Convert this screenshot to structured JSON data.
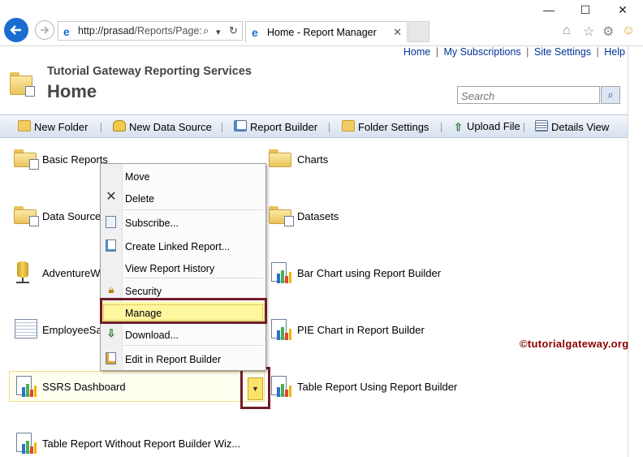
{
  "browser": {
    "address": "http://prasad/Reports/Page:",
    "address_host": "http://prasad",
    "address_path": "/Reports/Page:",
    "tab_title": "Home - Report Manager",
    "address_search_icon": "⌕",
    "address_refresh_icon": "↻"
  },
  "top_links": {
    "home": "Home",
    "subscriptions": "My Subscriptions",
    "site_settings": "Site Settings",
    "help": "Help",
    "separator": "|"
  },
  "header": {
    "site_title": "Tutorial Gateway Reporting Services",
    "page_title": "Home",
    "search_placeholder": "Search"
  },
  "toolbar": {
    "new_folder": "New Folder",
    "new_data_source": "New Data Source",
    "report_builder": "Report Builder",
    "folder_settings": "Folder Settings",
    "upload_file": "Upload File",
    "details_view": "Details View"
  },
  "items": {
    "basic_reports": "Basic Reports",
    "charts": "Charts",
    "data_sources": "Data Source",
    "datasets": "Datasets",
    "adventureworks": "AdventureWo",
    "bar_chart": "Bar Chart using Report Builder",
    "employee": "EmployeeSa",
    "pie_chart": "PIE Chart in Report Builder",
    "ssrs_dashboard": "SSRS Dashboard",
    "table_report_rb": "Table Report Using Report Builder",
    "table_report_wiz": "Table Report Without Report Builder Wiz..."
  },
  "context_menu": {
    "move": "Move",
    "delete": "Delete",
    "subscribe": "Subscribe...",
    "create_linked": "Create Linked Report...",
    "view_history": "View Report History",
    "security": "Security",
    "manage": "Manage",
    "download": "Download...",
    "edit_rb": "Edit in Report Builder"
  },
  "watermark": "©tutorialgateway.org",
  "colors": {
    "link": "#003399",
    "highlight": "#fff7a0",
    "frame": "#6e1d2a",
    "back_button": "#1a6dd0"
  }
}
